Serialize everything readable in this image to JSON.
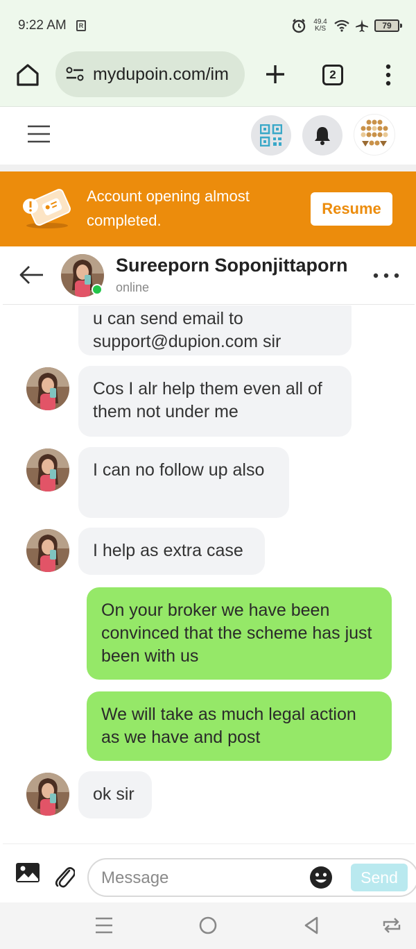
{
  "status_bar": {
    "time": "9:22 AM",
    "sim_badge": "R",
    "net_speed_value": "49.4",
    "net_speed_unit": "K/S",
    "battery": "79",
    "icons": [
      "alarm-icon",
      "wifi-icon",
      "airplane-icon",
      "battery-icon"
    ]
  },
  "browser": {
    "url": "mydupoin.com/im",
    "tab_count": "2",
    "icons": [
      "home-icon",
      "site-settings-icon",
      "plus-icon",
      "tabs-icon",
      "more-vertical-icon"
    ]
  },
  "app_header": {
    "icons": [
      "hamburger-menu-icon",
      "qr-code-icon",
      "bell-icon",
      "brand-logo-icon"
    ],
    "colors": {
      "qr": "#3aa8c8",
      "logo": "#c9924a"
    }
  },
  "banner": {
    "text": "Account opening almost completed.",
    "button_label": "Resume",
    "color": "#ec8c0c"
  },
  "chat": {
    "contact_name": "Sureeporn Soponjittaporn",
    "contact_status": "online",
    "status_color": "#22c54a",
    "messages": [
      {
        "direction": "in",
        "text": "u can send email to support@dupion.com sir",
        "show_avatar": false
      },
      {
        "direction": "in",
        "text": "Cos I alr help them even all of them not under me",
        "show_avatar": true
      },
      {
        "direction": "in",
        "text": "I can no follow up also",
        "show_avatar": true
      },
      {
        "direction": "in",
        "text": "I help as extra case",
        "show_avatar": true
      },
      {
        "direction": "out",
        "text": "On your broker we have been convinced that the scheme has just been with us",
        "show_avatar": false
      },
      {
        "direction": "out",
        "text": "We will take as much legal action as we have and post",
        "show_avatar": false
      },
      {
        "direction": "in",
        "text": "ok sir",
        "show_avatar": true
      }
    ],
    "colors": {
      "incoming": "#f2f3f5",
      "outgoing": "#95e868"
    }
  },
  "composer": {
    "placeholder": "Message",
    "send_label": "Send",
    "icons": [
      "image-icon",
      "paperclip-icon",
      "emoji-icon"
    ]
  },
  "nav_bar": {
    "icons": [
      "recent-apps-icon",
      "home-circle-icon",
      "back-triangle-icon",
      "rotate-icon"
    ]
  }
}
